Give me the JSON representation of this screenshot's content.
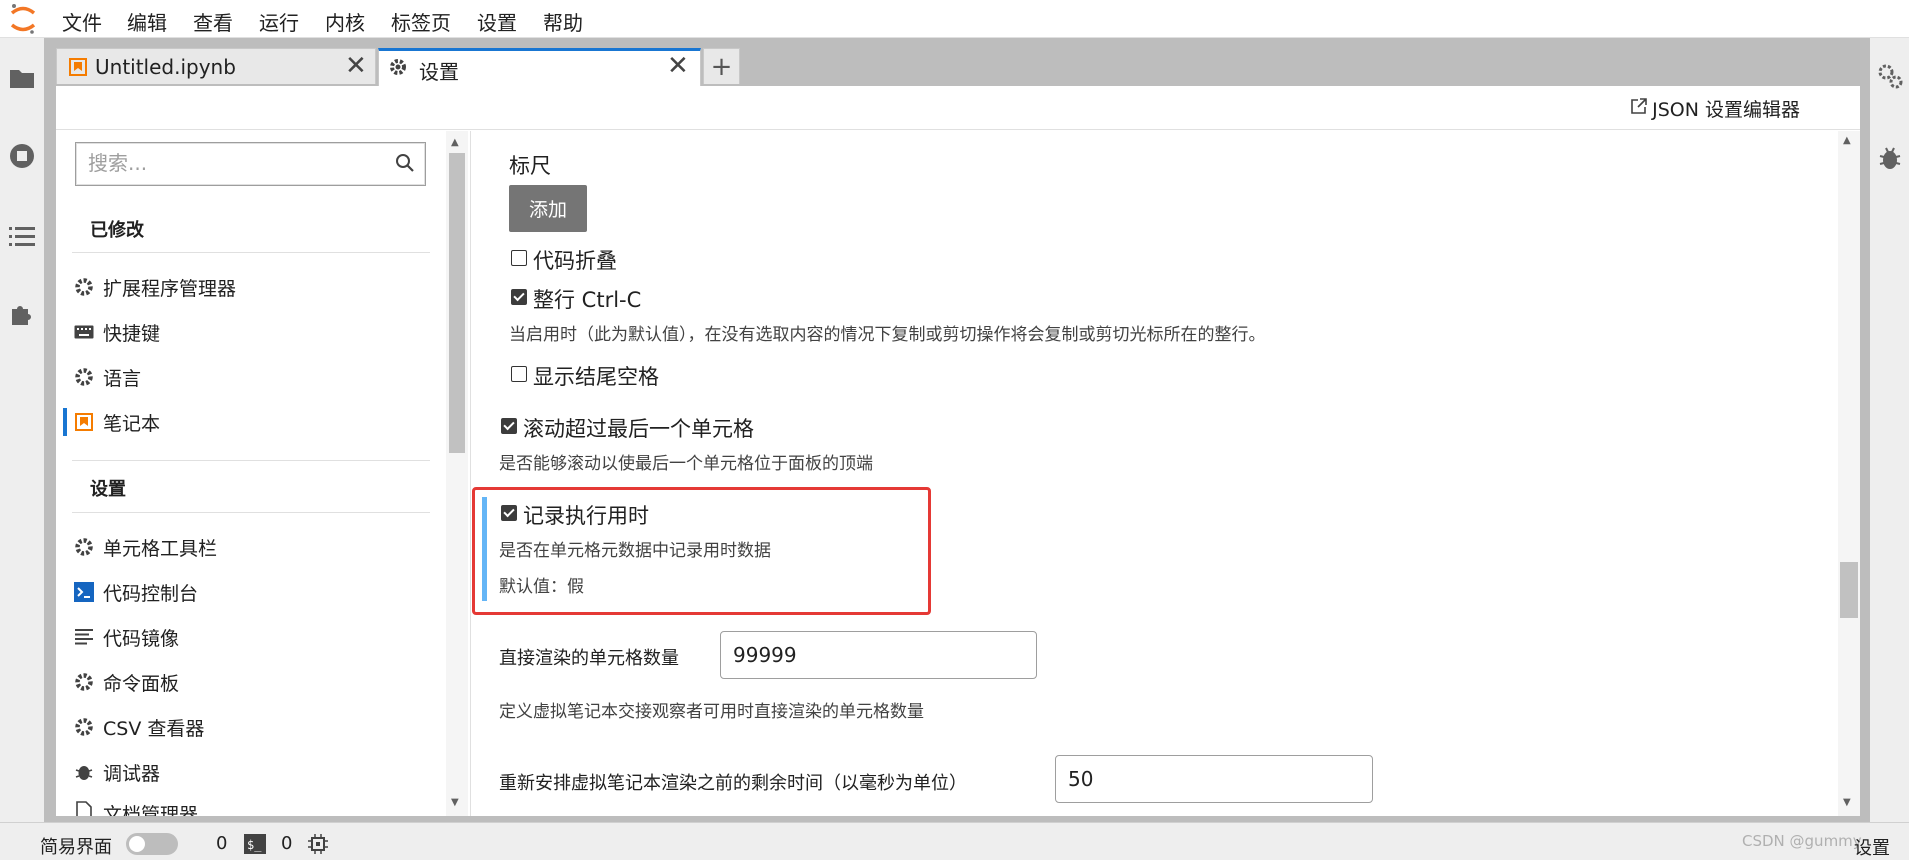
{
  "menubar": {
    "items": [
      "文件",
      "编辑",
      "查看",
      "运行",
      "内核",
      "标签页",
      "设置",
      "帮助"
    ]
  },
  "tabs": [
    {
      "label": "Untitled.ipynb",
      "close": "✕",
      "icon": "notebook-icon"
    },
    {
      "label": "设置",
      "close": "✕",
      "icon": "gear-icon"
    }
  ],
  "tab_add_label": "+",
  "toolbar": {
    "json_editor_label": "JSON 设置编辑器"
  },
  "search": {
    "placeholder": "搜索..."
  },
  "sidebar": {
    "modified_heading": "已修改",
    "modified_items": [
      {
        "label": "扩展程序管理器",
        "icon": "gear-icon"
      },
      {
        "label": "快捷键",
        "icon": "keyboard-icon"
      },
      {
        "label": "语言",
        "icon": "gear-icon"
      },
      {
        "label": "笔记本",
        "icon": "notebook-icon"
      }
    ],
    "settings_heading": "设置",
    "settings_items": [
      {
        "label": "单元格工具栏",
        "icon": "gear-icon"
      },
      {
        "label": "代码控制台",
        "icon": "console-icon"
      },
      {
        "label": "代码镜像",
        "icon": "codemirror-icon"
      },
      {
        "label": "命令面板",
        "icon": "gear-icon"
      },
      {
        "label": "CSV 查看器",
        "icon": "gear-icon"
      },
      {
        "label": "调试器",
        "icon": "bug-icon"
      },
      {
        "label": "文档管理器",
        "icon": "file-icon"
      }
    ]
  },
  "content": {
    "rulers_label": "标尺",
    "add_button": "添加",
    "code_folding": {
      "label": "代码折叠",
      "checked": false
    },
    "whole_line_copy": {
      "label": "整行 Ctrl-C",
      "checked": true,
      "description": "当启用时（此为默认值），在没有选取内容的情况下复制或剪切操作将会复制或剪切光标所在的整行。"
    },
    "show_trailing_space": {
      "label": "显示结尾空格",
      "checked": false
    },
    "scroll_past_end": {
      "label": "滚动超过最后一个单元格",
      "checked": true,
      "description": "是否能够滚动以使最后一个单元格位于面板的顶端"
    },
    "record_timing": {
      "label": "记录执行用时",
      "checked": true,
      "description": "是否在单元格元数据中记录用时数据",
      "default_text": "默认值：假"
    },
    "direct_render_count": {
      "label": "直接渲染的单元格数量",
      "value": "99999",
      "description": "定义虚拟笔记本交接观察者可用时直接渲染的单元格数量"
    },
    "rerender_wait": {
      "label": "重新安排虚拟笔记本渲染之前的剩余时间（以毫秒为单位）",
      "value": "50"
    }
  },
  "statusbar": {
    "simple_mode_label": "简易界面",
    "simple_mode_on": false,
    "kernels_count": "0",
    "terminals_count": "0",
    "right_label": "设置"
  },
  "watermark": "CSDN @gummy",
  "colors": {
    "accent": "#1976d2",
    "modified_bar": "#64b5f6",
    "highlight_box": "#e53935",
    "notebook_icon": "#f57c00"
  }
}
